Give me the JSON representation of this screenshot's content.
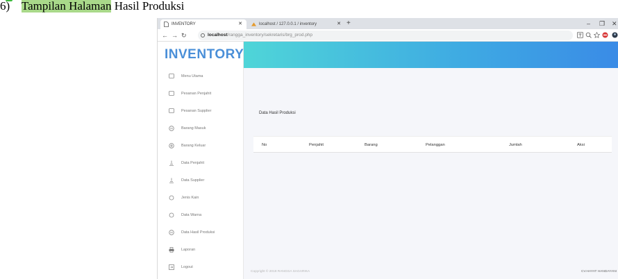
{
  "caption": {
    "number": "6)",
    "text_highlight": "Tampilan Halaman",
    "text_plain": "Hasil Produksi"
  },
  "browser": {
    "tabs": [
      {
        "label": "INVENTORY"
      },
      {
        "label": "localhost / 127.0.0.1 / inventory"
      }
    ],
    "url_host": "localhost",
    "url_path": "/rangga_inventory/sekretaris/brg_prod.php"
  },
  "app": {
    "brand": "INVENTORY",
    "sidebar": [
      {
        "label": "Menu Utama",
        "icon": "square-outline-icon"
      },
      {
        "label": "Pesanan Penjahit",
        "icon": "square-outline-icon"
      },
      {
        "label": "Pesanan Supplier",
        "icon": "square-outline-icon"
      },
      {
        "label": "Barang Masuk",
        "icon": "box-icon"
      },
      {
        "label": "Barang Keluar",
        "icon": "box-icon"
      },
      {
        "label": "Data Penjahit",
        "icon": "user-icon"
      },
      {
        "label": "Data Supplier",
        "icon": "user-icon"
      },
      {
        "label": "Jenis Kain",
        "icon": "circle-icon"
      },
      {
        "label": "Data Warna",
        "icon": "circle-icon"
      },
      {
        "label": "Data Hasil Produksi",
        "icon": "box-icon"
      },
      {
        "label": "Laporan",
        "icon": "printer-icon"
      },
      {
        "label": "Logout",
        "icon": "logout-icon"
      }
    ],
    "card_title": "Data Hasil Produksi",
    "table_headers": [
      "No",
      "Penjahit",
      "Barang",
      "Pelanggan",
      "Jumlah",
      "Aksi"
    ],
    "footer_left": "Copyright © 2019 RANGGA SAGARIKA",
    "footer_right": "CV.HAYAT HANDAYANI"
  },
  "colors": {
    "brand": "#4a8fd8",
    "topbar_start": "#4fd5d8",
    "topbar_end": "#3a8be6",
    "caption_highlight": "#a9d98a"
  }
}
